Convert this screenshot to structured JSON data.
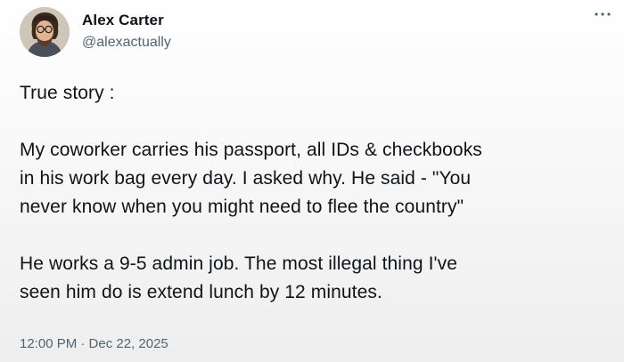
{
  "author": {
    "display_name": "Alex Carter",
    "handle": "@alexactually",
    "avatar_icon": "profile-photo"
  },
  "menu": {
    "icon": "more-horizontal-icon"
  },
  "tweet": {
    "paragraphs": [
      [
        "True story :"
      ],
      [
        "My coworker carries his passport, all IDs & checkbooks",
        "in his work bag every day. I asked why. He said - \"You",
        "never know when you might need to flee the country\""
      ],
      [
        "He works a 9-5 admin job. The most illegal thing I've",
        "seen him do is extend lunch by 12 minutes."
      ]
    ],
    "timestamp": "12:00 PM · Dec 22, 2025"
  },
  "colors": {
    "primary_text": "#0f1419",
    "secondary_text": "#536471"
  }
}
